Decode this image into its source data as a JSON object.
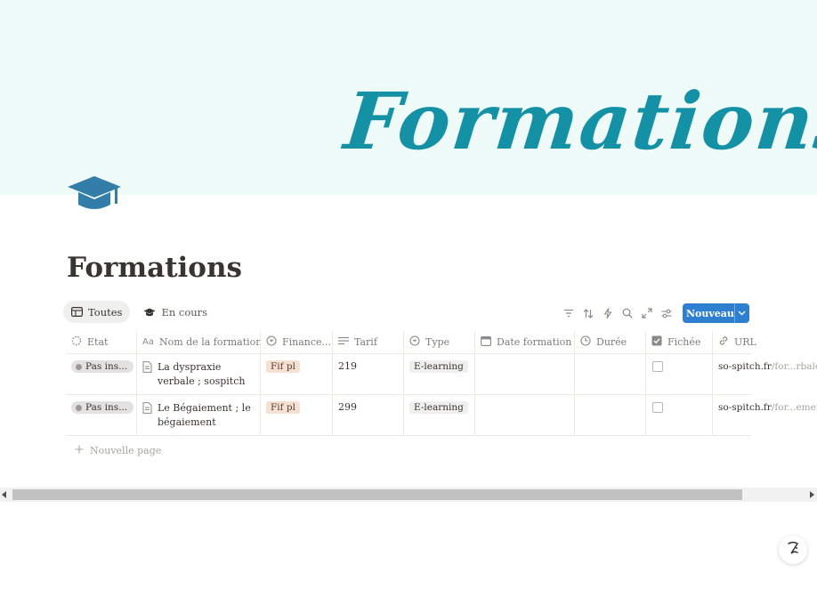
{
  "cover": {
    "text": "Formations",
    "color": "#1591a5",
    "background": "#effbf8"
  },
  "page": {
    "icon": "graduation-cap-icon",
    "title": "Formations"
  },
  "views": [
    {
      "label": "Toutes",
      "icon": "table-icon",
      "active": true
    },
    {
      "label": "En cours",
      "icon": "graduation-cap-icon",
      "active": false
    }
  ],
  "toolbar": {
    "icons": [
      "filter-icon",
      "sort-icon",
      "automation-icon",
      "search-icon",
      "expand-icon",
      "settings-icon"
    ],
    "new_label": "Nouveau"
  },
  "table": {
    "columns": [
      {
        "label": "Etat",
        "icon": "status-icon"
      },
      {
        "label": "Nom de la formation",
        "icon": "text-property-icon"
      },
      {
        "label": "Finance...",
        "icon": "select-icon"
      },
      {
        "label": "Tarif",
        "icon": "text-lines-icon"
      },
      {
        "label": "Type",
        "icon": "select-icon"
      },
      {
        "label": "Date formation",
        "icon": "calendar-icon"
      },
      {
        "label": "Durée",
        "icon": "clock-icon"
      },
      {
        "label": "Fichée",
        "icon": "checkbox-icon"
      },
      {
        "label": "URL",
        "icon": "link-icon"
      }
    ],
    "rows": [
      {
        "status": "Pas ins...",
        "name": "La dyspraxie verbale ; sospitch",
        "financement": "Fif pl",
        "tarif": "219",
        "type": "E-learning",
        "date": "",
        "duree": "",
        "fichee": false,
        "url_domain": "so-spitch.fr",
        "url_path": "/for...rbale/"
      },
      {
        "status": "Pas ins...",
        "name": "Le Bégaiement ; le bégaiement",
        "financement": "Fif pl",
        "tarif": "299",
        "type": "E-learning",
        "date": "",
        "duree": "",
        "fichee": false,
        "url_domain": "so-spitch.fr",
        "url_path": "/for...ement"
      }
    ],
    "new_page_label": "Nouvelle page"
  },
  "colors": {
    "accent": "#2f7fd1",
    "status_badge": "#e3e2e0",
    "tag_financement": "#f5e0d4"
  }
}
